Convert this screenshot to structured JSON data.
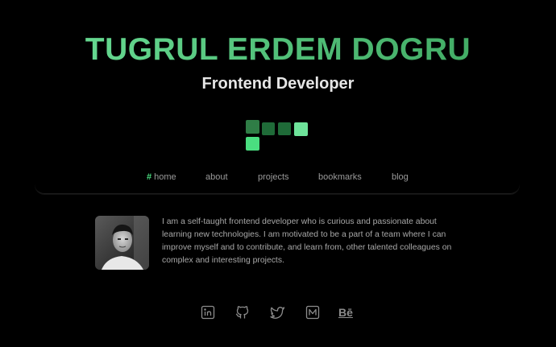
{
  "header": {
    "title": "TUGRUL ERDEM DOGRU",
    "subtitle": "Frontend Developer",
    "logo_colors": [
      "#2f7d46",
      "#1f6b38",
      "#1f6b38",
      "#6ee39a",
      "#4ade80"
    ]
  },
  "nav": {
    "items": [
      {
        "label": "home",
        "prefix": "#",
        "active": true
      },
      {
        "label": "about"
      },
      {
        "label": "projects"
      },
      {
        "label": "bookmarks"
      },
      {
        "label": "blog"
      }
    ]
  },
  "about": {
    "bio": "I am a self-taught frontend developer who is curious and passionate about learning new technologies. I am motivated to be a part of a team where I can improve myself and to contribute, and learn from, other talented colleagues on complex and interesting projects."
  },
  "social": {
    "icons": [
      "linkedin-icon",
      "github-icon",
      "twitter-icon",
      "medium-icon",
      "behance-icon"
    ],
    "behance_glyph": "Bē"
  },
  "colors": {
    "accent": "#4ade80",
    "background": "#000000",
    "text_muted": "#a8a8a8"
  }
}
